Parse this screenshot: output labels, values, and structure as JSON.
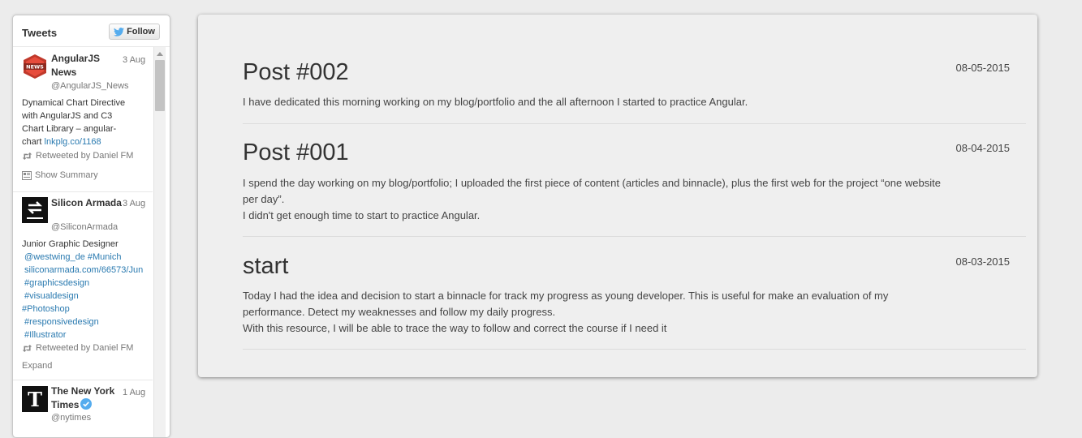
{
  "twitter_widget": {
    "title": "Tweets",
    "follow_label": "Follow",
    "tweets": [
      {
        "name_line1": "AngularJS",
        "name_line2": "News",
        "date": "3 Aug",
        "handle": "@AngularJS_News",
        "text": "Dynamical Chart Directive\nwith AngularJS and C3\nChart Library – angular-\nchart ",
        "link": "lnkplg.co/1168",
        "retweeted_by": "Retweeted by Daniel FM",
        "action": "Show Summary",
        "avatar_label": "NEWS"
      },
      {
        "name_line1": "Silicon Armada",
        "date": "3 Aug",
        "handle": "@SiliconArmada",
        "text_intro": "Junior Graphic Designer",
        "links": [
          " @westwing_de #Munich",
          " siliconarmada.com/66573/Jun",
          " #graphicsdesign",
          " #visualdesign",
          "#Photoshop",
          " #responsivedesign",
          " #Illustrator"
        ],
        "retweeted_by": "Retweeted by Daniel FM",
        "action": "Expand"
      },
      {
        "name_line1": "The New York",
        "name_line2": "Times",
        "date": "1 Aug",
        "handle": "@nytimes"
      }
    ]
  },
  "posts": [
    {
      "title": "Post #002",
      "date": "08-05-2015",
      "lines": [
        "I have dedicated this morning working on my blog/portfolio and the all afternoon I started to practice Angular."
      ]
    },
    {
      "title": "Post #001",
      "date": "08-04-2015",
      "lines": [
        "I spend the day working on my blog/portfolio; I uploaded the first piece of content (articles and binnacle), plus the first web for the project “one website",
        "per day”.",
        "I didn't get enough time to start to practice Angular."
      ]
    },
    {
      "title": "start",
      "date": "08-03-2015",
      "lines": [
        "Today I had the idea and decision to start a binnacle for track my progress as young developer. This is useful for make an evaluation of my",
        "performance. Detect my weaknesses and follow my daily progress.",
        "With this resource, I will be able to trace the way to follow and correct the course if I need it"
      ]
    }
  ],
  "colors": {
    "link": "#2a7ab0",
    "twitter_blue": "#55acee",
    "page_background": "#ececec",
    "panel_background": "#efefef"
  }
}
